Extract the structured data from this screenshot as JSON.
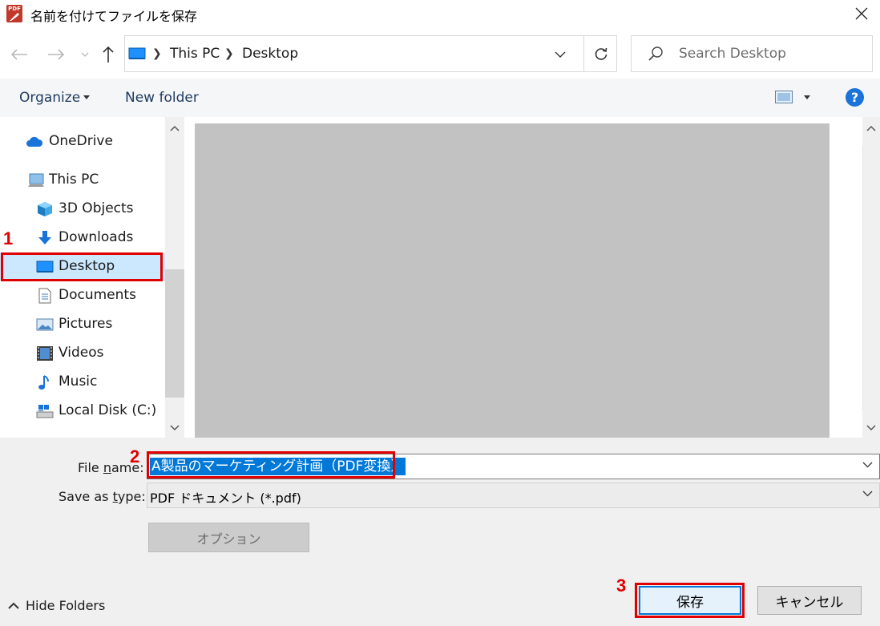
{
  "window": {
    "title": "名前を付けてファイルを保存",
    "app_icon_text": "PDF"
  },
  "address": {
    "crumbs": [
      "This PC",
      "Desktop"
    ]
  },
  "search": {
    "placeholder": "Search Desktop"
  },
  "toolbar": {
    "organize": "Organize",
    "new_folder": "New folder",
    "help": "?"
  },
  "nav": {
    "items": [
      {
        "label": "OneDrive",
        "icon": "cloud-icon"
      },
      {
        "label": "This PC",
        "icon": "computer-icon"
      },
      {
        "label": "3D Objects",
        "icon": "cube-icon"
      },
      {
        "label": "Downloads",
        "icon": "download-arrow-icon"
      },
      {
        "label": "Desktop",
        "icon": "desktop-icon",
        "selected": true
      },
      {
        "label": "Documents",
        "icon": "document-icon"
      },
      {
        "label": "Pictures",
        "icon": "picture-icon"
      },
      {
        "label": "Videos",
        "icon": "film-icon"
      },
      {
        "label": "Music",
        "icon": "music-note-icon"
      },
      {
        "label": "Local Disk (C:)",
        "icon": "drive-icon"
      }
    ]
  },
  "form": {
    "file_name_label_pre": "File ",
    "file_name_label_u": "n",
    "file_name_label_post": "ame:",
    "file_name_value": "A製品のマーケティング計画（PDF変換）",
    "save_type_label_pre": "Save as ",
    "save_type_label_u": "t",
    "save_type_label_post": "ype:",
    "save_type_value": "PDF ドキュメント (*.pdf)",
    "options_label": "オプション"
  },
  "footer": {
    "hide_folders": "Hide Folders",
    "save": "保存",
    "cancel": "キャンセル"
  },
  "annotations": {
    "m1": "1",
    "m2": "2",
    "m3": "3"
  },
  "colors": {
    "accent": "#0078d7",
    "highlight": "#e00000",
    "selected_bg": "#cce8ff"
  }
}
